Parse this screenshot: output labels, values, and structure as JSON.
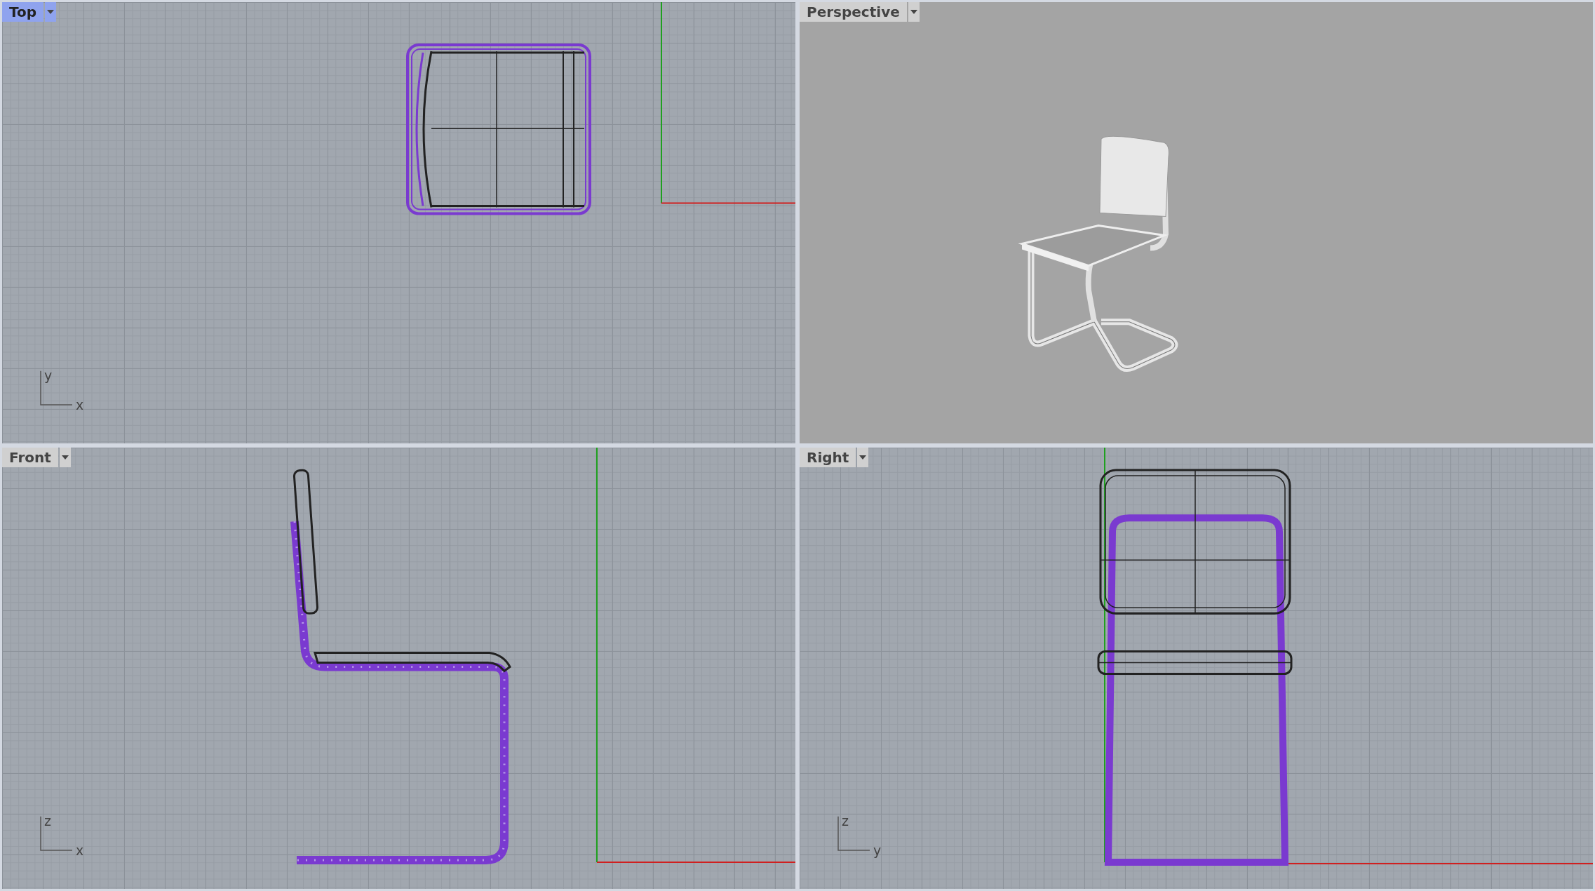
{
  "viewports": [
    {
      "title": "Top",
      "selected": true,
      "kind": "top",
      "axes": [
        "y",
        "x"
      ]
    },
    {
      "title": "Perspective",
      "selected": false,
      "kind": "perspective"
    },
    {
      "title": "Front",
      "selected": false,
      "kind": "front",
      "axes": [
        "z",
        "x"
      ]
    },
    {
      "title": "Right",
      "selected": false,
      "kind": "right",
      "axes": [
        "z",
        "y"
      ]
    }
  ]
}
